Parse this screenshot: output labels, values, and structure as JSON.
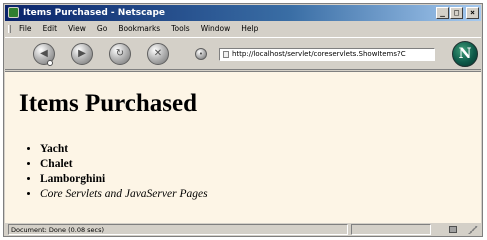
{
  "window": {
    "title": "Items Purchased - Netscape",
    "controls": {
      "minimize": "_",
      "maximize": "□",
      "close": "×"
    }
  },
  "menu": {
    "items": [
      "File",
      "Edit",
      "View",
      "Go",
      "Bookmarks",
      "Tools",
      "Window",
      "Help"
    ]
  },
  "navbar": {
    "back_icon": "back-arrow",
    "forward_icon": "forward-arrow",
    "reload_icon": "reload",
    "stop_icon": "stop",
    "url": "http://localhost/servlet/coreservlets.ShowItems?C",
    "logo_letter": "N"
  },
  "page": {
    "heading": "Items Purchased",
    "items": [
      {
        "text": "Yacht",
        "style": "bold"
      },
      {
        "text": "Chalet",
        "style": "bold"
      },
      {
        "text": "Lamborghini",
        "style": "bold"
      },
      {
        "text": "Core Servlets and JavaServer Pages",
        "style": "italic"
      }
    ]
  },
  "status": {
    "text": "Document: Done (0.08 secs)"
  }
}
